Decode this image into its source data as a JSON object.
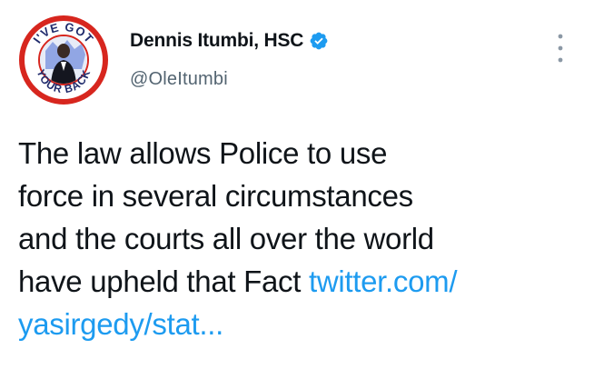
{
  "tweet": {
    "author": {
      "display_name": "Dennis Itumbi, HSC",
      "handle": "@OleItumbi",
      "avatar_badge_text": "I'VE GOT YOUR BACK"
    },
    "body": {
      "line1": "The law allows Police to use",
      "line2": "force in several circumstances",
      "line3": "and the courts all over the world",
      "line4_text": "have upheld that Fact ",
      "line4_link": "twitter.com/",
      "line5_link": "yasirgedy/stat..."
    }
  },
  "colors": {
    "link": "#1d9bf0",
    "verified": "#1d9bf0",
    "text": "#0f1419",
    "secondary": "#536471",
    "badge_red": "#d7261e",
    "badge_blue": "#2c4fbf"
  },
  "icons": {
    "verified": "verified-badge-icon",
    "more": "more-options-icon"
  }
}
